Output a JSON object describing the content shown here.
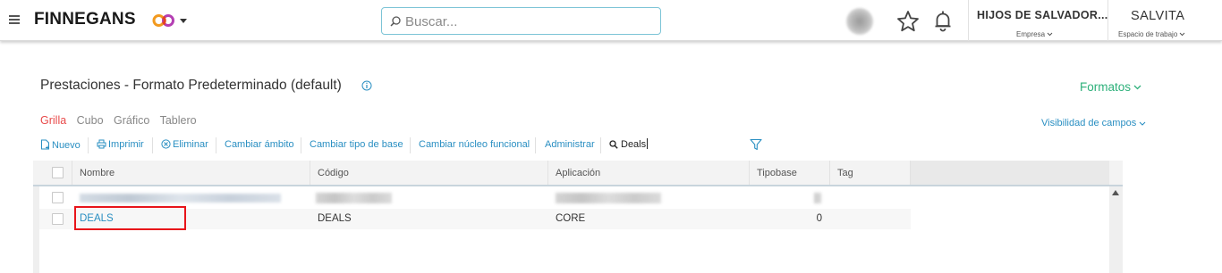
{
  "header": {
    "brand": "FINNEGANS",
    "search": {
      "placeholder": "Buscar...",
      "value": ""
    },
    "company": {
      "name": "HIJOS DE SALVADOR...",
      "label": "Empresa"
    },
    "workspace": {
      "name": "SALVITA",
      "label": "Espacio de trabajo"
    }
  },
  "page": {
    "title": "Prestaciones - Formato Predeterminado (default)",
    "formatos_label": "Formatos",
    "visibilidad_label": "Visibilidad de campos",
    "tabs": [
      {
        "label": "Grilla",
        "active": true
      },
      {
        "label": "Cubo",
        "active": false
      },
      {
        "label": "Gráfico",
        "active": false
      },
      {
        "label": "Tablero",
        "active": false
      }
    ]
  },
  "toolbar": {
    "nuevo": "Nuevo",
    "imprimir": "Imprimir",
    "eliminar": "Eliminar",
    "cambiar_ambito": "Cambiar ámbito",
    "cambiar_tipo_base": "Cambiar tipo de base",
    "cambiar_nucleo": "Cambiar núcleo funcional",
    "administrar": "Administrar",
    "search_value": "Deals"
  },
  "grid": {
    "columns": [
      "Nombre",
      "Código",
      "Aplicación",
      "Tipobase",
      "Tag"
    ],
    "rows": [
      {
        "nombre": "DEALS",
        "codigo": "DEALS",
        "aplicacion": "CORE",
        "tipobase": "0",
        "tag": ""
      }
    ]
  },
  "colors": {
    "accent_blue": "#2a8fc2",
    "accent_green": "#2db07a",
    "active_tab_red": "#e84a4a",
    "highlight_red": "#e8141a"
  }
}
